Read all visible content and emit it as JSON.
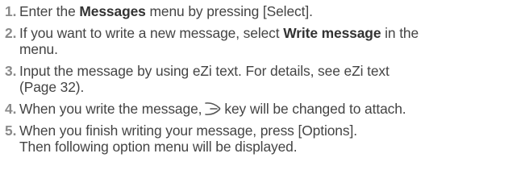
{
  "steps": [
    {
      "number": "1.",
      "before": "Enter the ",
      "bold": "Messages",
      "after": " menu by pressing [Select]."
    },
    {
      "number": "2.",
      "before": "If you want to write a new message, select ",
      "bold": "Write message",
      "after": " in the",
      "line2": "menu."
    },
    {
      "number": "3.",
      "line1": "Input the message by using eZi text. For details, see eZi text",
      "line2": "(Page 32)."
    },
    {
      "number": "4.",
      "before": "When you write the message,",
      "icon": "soft-key-icon",
      "after": "key will be changed to attach."
    },
    {
      "number": "5.",
      "line1": "When you finish writing your message, press [Options].",
      "line2": "Then following option menu will be displayed."
    }
  ]
}
